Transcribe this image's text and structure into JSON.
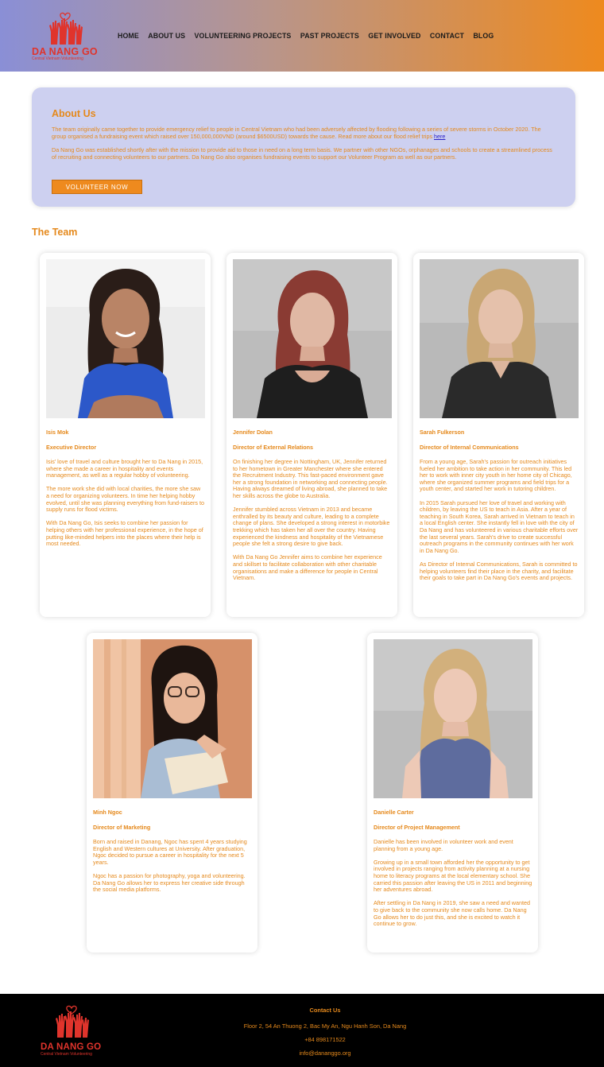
{
  "brand": {
    "name": "DA NANG GO",
    "tagline": "Central Vietnam Volunteering",
    "logo_icon": "raised-hands-heart-icon",
    "colors": {
      "orange": "#e5891c",
      "logo_red": "#e0342c",
      "about_bg": "#cdd0f0",
      "link": "#2b22c8"
    }
  },
  "nav": {
    "items": [
      {
        "label": "HOME"
      },
      {
        "label": "ABOUT US"
      },
      {
        "label": "VOLUNTEERING PROJECTS"
      },
      {
        "label": "PAST PROJECTS"
      },
      {
        "label": "GET INVOLVED"
      },
      {
        "label": "CONTACT"
      },
      {
        "label": "BLOG"
      }
    ]
  },
  "about": {
    "title": "About Us",
    "p1": "The team originally came together to provide emergency relief to people in Central Vietnam who had been adversely affected by flooding following a series of severe storms in October 2020. The group organised a fundraising event which raised over 150,000,000VND (around $6500USD) towards the cause. Read more about our flood relief trips ",
    "p1_link": "here",
    "p2": "Da Nang Go was established shortly after with the mission to provide aid to those in need on a long term basis. We partner with other NGOs, orphanages and schools to create a streamlined process of recruiting and connecting volunteers to our partners. Da Nang Go also organises fundraising events to support our Volunteer Program as well as our partners.",
    "button": "VOLUNTEER NOW"
  },
  "team": {
    "title": "The Team",
    "members": [
      {
        "name": "Isis Mok",
        "role": "Executive Director",
        "bio": [
          "Isis' love of travel and culture brought her to Da Nang in 2015, where she made a career in hospitality and events management, as well as a regular hobby of volunteering.",
          "The more work she did with local charities, the more she saw a need for organizing volunteers. In time her helping hobby evolved, until she was planning everything from fund-raisers to supply runs for flood victims.",
          "With Da Nang Go, Isis seeks to combine her passion for helping others with her professional experience, in the hope of putting like-minded helpers into the places where their help is most needed."
        ]
      },
      {
        "name": "Jennifer Dolan",
        "role": "Director of External Relations",
        "bio": [
          "On finishing her degree in Nottingham, UK, Jennifer returned to her hometown in Greater Manchester where she entered the Recruitment Industry. This fast-paced environment gave her a strong foundation in networking and connecting people. Having always dreamed of living abroad, she planned to take her skills across the globe to Australia.",
          "Jennifer stumbled across Vietnam in 2013 and became enthralled by its beauty and culture, leading to a complete change of plans. She developed a strong interest in motorbike trekking which has taken her all over the country. Having experienced the kindness and hospitality of the Vietnamese people she felt a strong desire to give back.",
          "With Da Nang Go Jennifer aims to combine her experience and skillset to facilitate collaboration with other charitable organisations and make a difference for people in Central Vietnam."
        ]
      },
      {
        "name": "Sarah Fulkerson",
        "role": "Director of Internal Communications",
        "bio": [
          "From a young age, Sarah's passion for outreach initiatives fueled her ambition to take action in her community. This led her to work with inner city youth in her home city of Chicago, where she organized summer programs and field trips for a youth center, and started her work in tutoring children.",
          "In 2015 Sarah pursued her love of travel and working with children, by leaving the US to teach in Asia. After a year of teaching in South Korea, Sarah arrived in Vietnam to teach in a local English center. She instantly fell in love with the city of Da Nang and has volunteered in various charitable efforts over the last several years. Sarah's drive to create successful outreach programs in the community continues with her work in Da Nang Go.",
          "As Director of Internal Communications, Sarah is committed to helping volunteers find their place in the charity, and facilitate their goals to take part in Da Nang Go's events and projects."
        ]
      },
      {
        "name": "Minh Ngoc",
        "role": "Director of Marketing",
        "bio": [
          "Born and raised in Danang, Ngoc has spent 4 years studying English and Western cultures at University. After graduation, Ngoc decided to pursue a career in hospitality for the next 5 years.",
          "Ngoc has a passion for photography, yoga and volunteering. Da Nang Go allows her to express her creative side through the social media platforms."
        ]
      },
      {
        "name": "Danielle Carter",
        "role": "Director of Project Management",
        "bio": [
          "Danielle has been involved in volunteer work and event planning from a young age.",
          "Growing up in a small town afforded her the opportunity to get involved in projects ranging from activity planning at a nursing home to literacy programs at the local elementary school. She carried this passion after leaving the US in 2011 and beginning her adventures abroad.",
          "After settling in Da Nang in 2019, she saw a need and wanted to give back to the community she now calls home. Da Nang Go allows her to do just this, and she is excited to watch it continue to grow."
        ]
      }
    ]
  },
  "footer": {
    "heading": "Contact Us",
    "address": "Floor 2, 54 An Thuong 2, Bac My An, Ngu Hanh Son, Da Nang",
    "phone": "+84 898171522",
    "email": "info@dananggo.org"
  }
}
